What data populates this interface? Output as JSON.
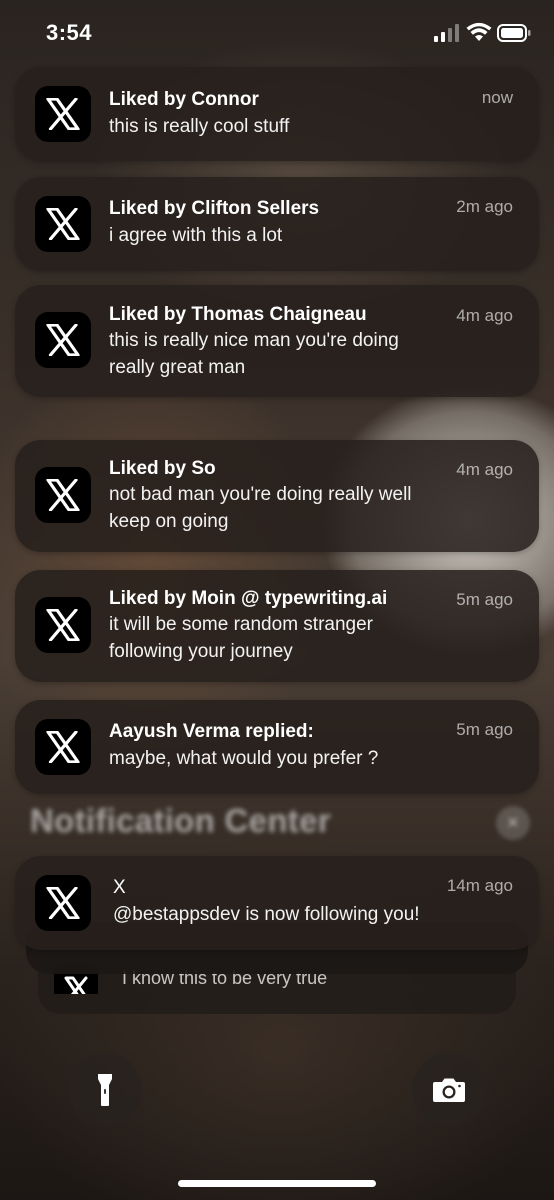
{
  "status_bar": {
    "time": "3:54"
  },
  "notifications": [
    {
      "title": "Liked by Connor",
      "body": [
        "this is really cool stuff"
      ],
      "time": "now"
    },
    {
      "title": "Liked by Clifton Sellers",
      "body": [
        "i agree with this a lot"
      ],
      "time": "2m ago"
    },
    {
      "title": "Liked by Thomas Chaigneau",
      "body": [
        "this is really nice man you're doing",
        "really great man"
      ],
      "time": "4m ago"
    },
    {
      "title": "Liked by So",
      "body": [
        "not bad man you're doing really well",
        "keep on going"
      ],
      "time": "4m ago"
    },
    {
      "title": "Liked by Moin @ typewriting.ai",
      "body": [
        "it will be some random stranger",
        "following your journey"
      ],
      "time": "5m ago"
    },
    {
      "title": "Aayush Verma replied:",
      "body": [
        "maybe, what would you prefer ?"
      ],
      "time": "5m ago"
    }
  ],
  "notification_center": {
    "header": "Notification Center",
    "close_glyph": "×",
    "stack": {
      "title": "X",
      "body": "@bestappsdev is now following you!",
      "time": "14m ago",
      "behind_text": "I know this to be very true"
    }
  },
  "icons": {
    "app_icon": "x-logo-icon",
    "flashlight": "flashlight-icon",
    "camera": "camera-icon"
  },
  "colors": {
    "notification_bg": "#26201c",
    "app_icon_bg": "#000000",
    "text": "#ffffff"
  }
}
